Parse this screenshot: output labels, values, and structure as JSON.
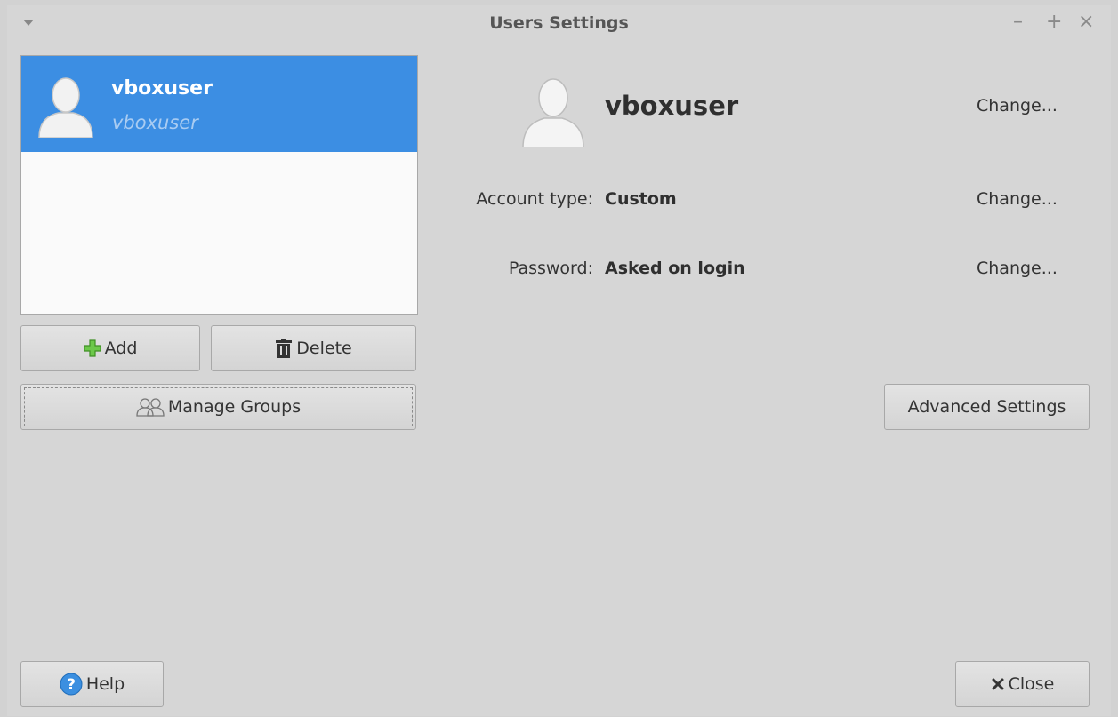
{
  "window": {
    "title": "Users Settings",
    "controls": {
      "minimize": "–",
      "maximize": "+",
      "close": "×"
    }
  },
  "user_list": [
    {
      "name": "vboxuser",
      "login": "vboxuser",
      "selected": true
    }
  ],
  "buttons": {
    "add": "Add",
    "delete": "Delete",
    "manage_groups": "Manage Groups",
    "advanced_settings": "Advanced Settings",
    "help": "Help",
    "close": "Close"
  },
  "details": {
    "name": "vboxuser",
    "name_change": "Change...",
    "account_type_label": "Account type:",
    "account_type_value": "Custom",
    "account_type_change": "Change...",
    "password_label": "Password:",
    "password_value": "Asked on login",
    "password_change": "Change..."
  },
  "icons": {
    "avatar": "user-avatar-icon",
    "add": "plus-icon",
    "delete": "trash-icon",
    "groups": "group-icon",
    "help": "help-icon",
    "close": "close-x-icon"
  },
  "colors": {
    "selection": "#3c8ee3",
    "window_bg": "#d6d6d6",
    "add_icon": "#4caf2f",
    "help_icon": "#3b8fe0"
  }
}
